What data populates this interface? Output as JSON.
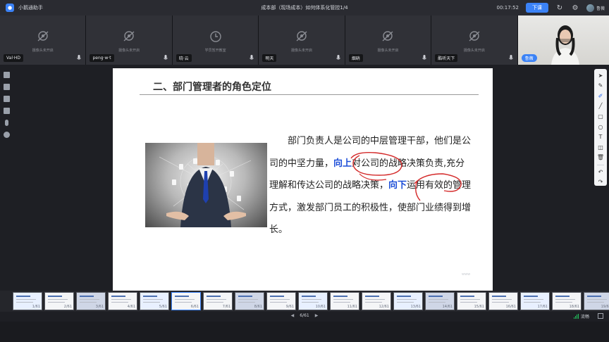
{
  "app": {
    "name": "小鹅通助手",
    "window_title": "成本部（现场成本）如何体系化管控1/4",
    "timer": "00:17:52",
    "down_button": "下课",
    "user_name": "鲁薇",
    "icons": [
      "refresh-icon",
      "gear-icon",
      "avatar"
    ]
  },
  "video_strip": {
    "tiles": [
      {
        "name": "Val·HD",
        "status": "摄像头未开启"
      },
      {
        "name": "peng·w·t",
        "status": "摄像头未开启"
      },
      {
        "name": "晓·云",
        "status": "学员暂开教室"
      },
      {
        "name": "明天",
        "status": "摄像头未开启"
      },
      {
        "name": "烟硝",
        "status": "摄像头未开启"
      },
      {
        "name": "酷听天下",
        "status": "摄像头未开启"
      }
    ],
    "teacher_name": "鲁薇"
  },
  "slide": {
    "title": "二、部门管理者的角色定位",
    "paragraph": {
      "part1": "部门负责人是公司的中层管理干部，他们是公司的中坚力量，",
      "hl_up": "向上",
      "part2": "对公司的战略决策负责,充分理解和传达公司的战略决策，",
      "hl_down": "向下",
      "part3": "运用有效的管理方式，激发部门员工的积极性，使部门业绩得到增长。"
    }
  },
  "filmstrip": {
    "pages": [
      "1/61",
      "2/61",
      "3/61",
      "4/61",
      "5/61",
      "6/61",
      "7/61",
      "8/61",
      "9/61",
      "10/61",
      "11/61",
      "12/61",
      "13/61",
      "14/61",
      "15/61",
      "16/61",
      "17/61",
      "18/61",
      "19/61"
    ],
    "active_index": 5
  },
  "bottom": {
    "page_indicator": "6/61",
    "network": "流畅"
  },
  "colors": {
    "accent": "#3b82f6",
    "highlight_text": "#1d4ed8",
    "ink_red": "#d42a2a"
  }
}
